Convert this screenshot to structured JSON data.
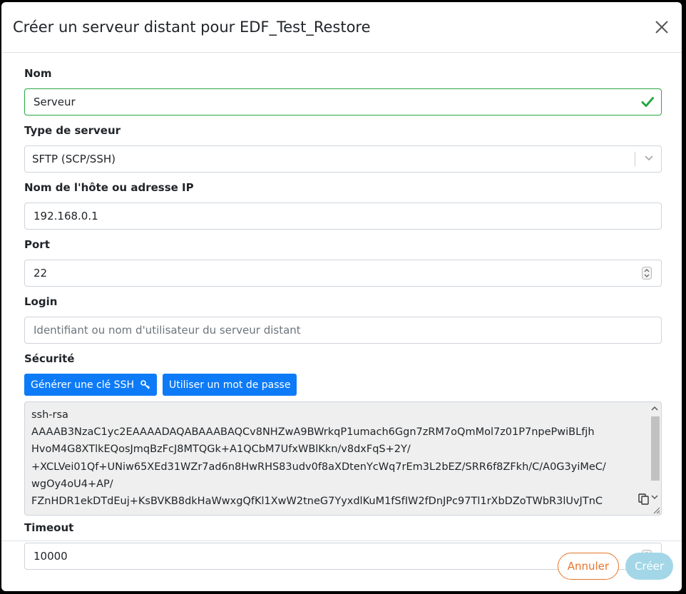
{
  "dialog": {
    "title": "Créer un serveur distant pour EDF_Test_Restore",
    "close_icon": "close-icon"
  },
  "fields": {
    "name": {
      "label": "Nom",
      "value": "Serveur",
      "state_icon": "check-icon",
      "state_color": "#28a745"
    },
    "server_type": {
      "label": "Type de serveur",
      "value": "SFTP (SCP/SSH)"
    },
    "host": {
      "label": "Nom de l'hôte ou adresse IP",
      "value": "192.168.0.1"
    },
    "port": {
      "label": "Port",
      "value": "22"
    },
    "login": {
      "label": "Login",
      "placeholder": "Identifiant ou nom d'utilisateur du serveur distant",
      "value": ""
    },
    "security": {
      "label": "Sécurité",
      "generate_button": "Générer une clé SSH",
      "generate_icon": "key-icon",
      "password_button": "Utiliser un mot de passe",
      "ssh_key": "ssh-rsa\nAAAAB3NzaC1yc2EAAAADAQABAAABAQCv8NHZwA9BWrkqP1umach6Ggn7zRM7oQmMol7z01P7npePwiBLfjh\nHvoM4G8XTlkEQosJmqBzFcJ8MTQGk+A1QCbM7UfxWBlKkn/v8dxFqS+2Y/\n+XCLVei01Qf+UNiw65XEd31WZr7ad6n8HwRHS83udv0f8aXDtenYcWq7rEm3L2bEZ/SRR6f8ZFkh/C/A0G3yiMeC/\nwgOy4oU4+AP/\nFZnHDR1ekDTdEuj+KsBVKB8dkHaWwxgQfKl1XwW2tneG7YyxdlKuM1fSfIW2fDnJPc97Tl1rXbDZoTWbR3lUvJTnC",
      "copy_icon": "copy-icon"
    },
    "timeout": {
      "label": "Timeout",
      "value": "10000"
    }
  },
  "footer": {
    "cancel_label": "Annuler",
    "create_label": "Créer"
  },
  "colors": {
    "primary": "#0d7bf7",
    "cancel": "#e8742a",
    "create_disabled": "#a3d7e7",
    "valid": "#28a745"
  }
}
